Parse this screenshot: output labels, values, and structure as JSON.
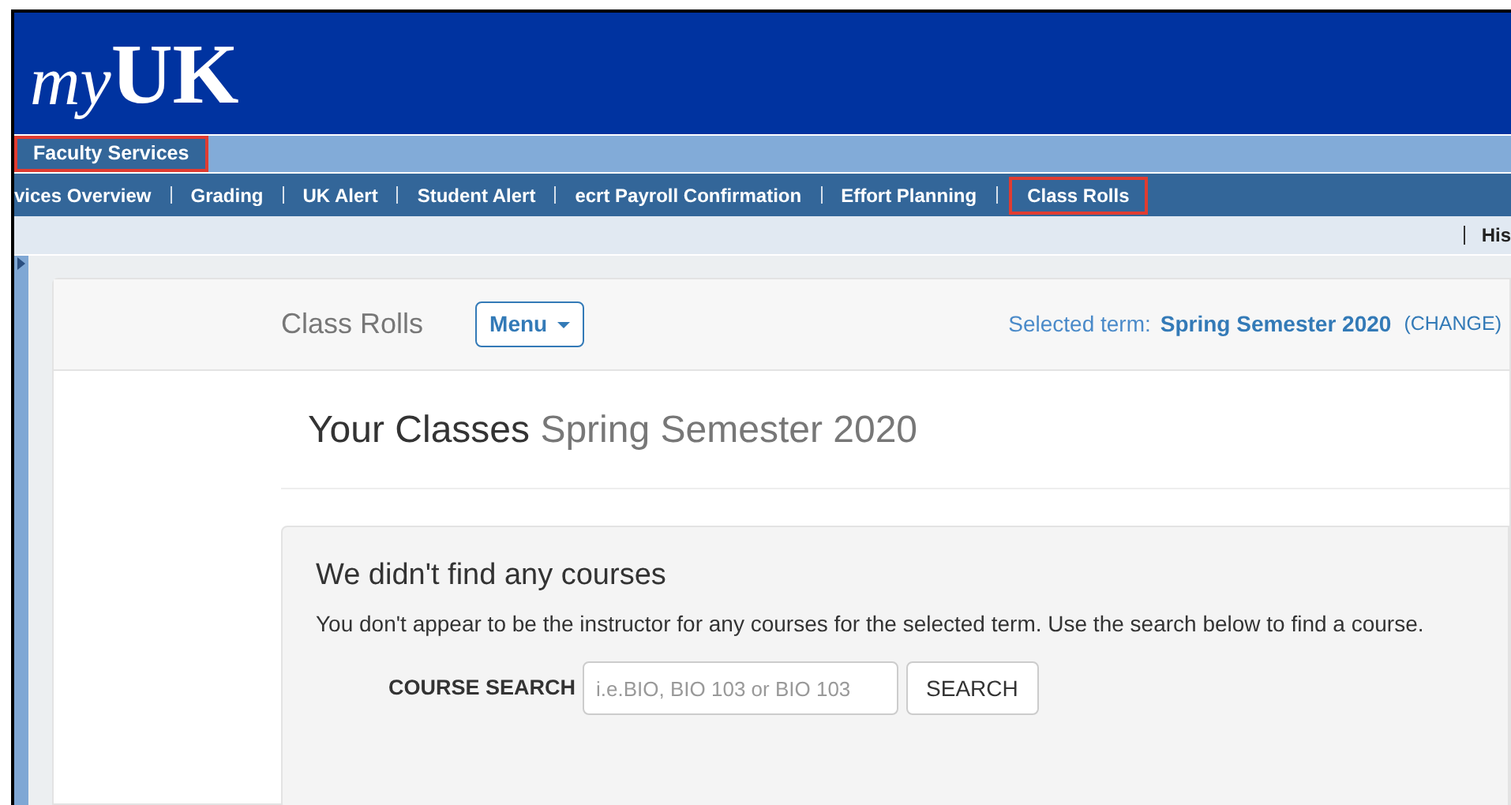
{
  "logo": {
    "prefix": "my",
    "mark": "UK"
  },
  "tabs": [
    {
      "label": "Faculty Services",
      "selected": true,
      "highlighted": true
    }
  ],
  "nav": [
    {
      "label": "vices Overview",
      "highlighted": false
    },
    {
      "label": "Grading",
      "highlighted": false
    },
    {
      "label": "UK Alert",
      "highlighted": false
    },
    {
      "label": "Student Alert",
      "highlighted": false
    },
    {
      "label": "ecrt Payroll Confirmation",
      "highlighted": false
    },
    {
      "label": "Effort Planning",
      "highlighted": false
    },
    {
      "label": "Class Rolls",
      "highlighted": true
    }
  ],
  "utility_links": [
    "His"
  ],
  "page_header": {
    "title": "Class Rolls",
    "menu_button": "Menu",
    "term_label": "Selected term:",
    "term": "Spring Semester 2020",
    "change_link": "(CHANGE)"
  },
  "heading": {
    "title": "Your Classes",
    "subtitle": "Spring Semester 2020"
  },
  "notice": {
    "title": "We didn't find any courses",
    "message": "You don't appear to be the instructor for any courses for the selected term. Use the search below to find a course."
  },
  "course_search": {
    "label": "COURSE SEARCH",
    "placeholder": "i.e.BIO, BIO 103 or BIO 103",
    "button": "SEARCH"
  }
}
